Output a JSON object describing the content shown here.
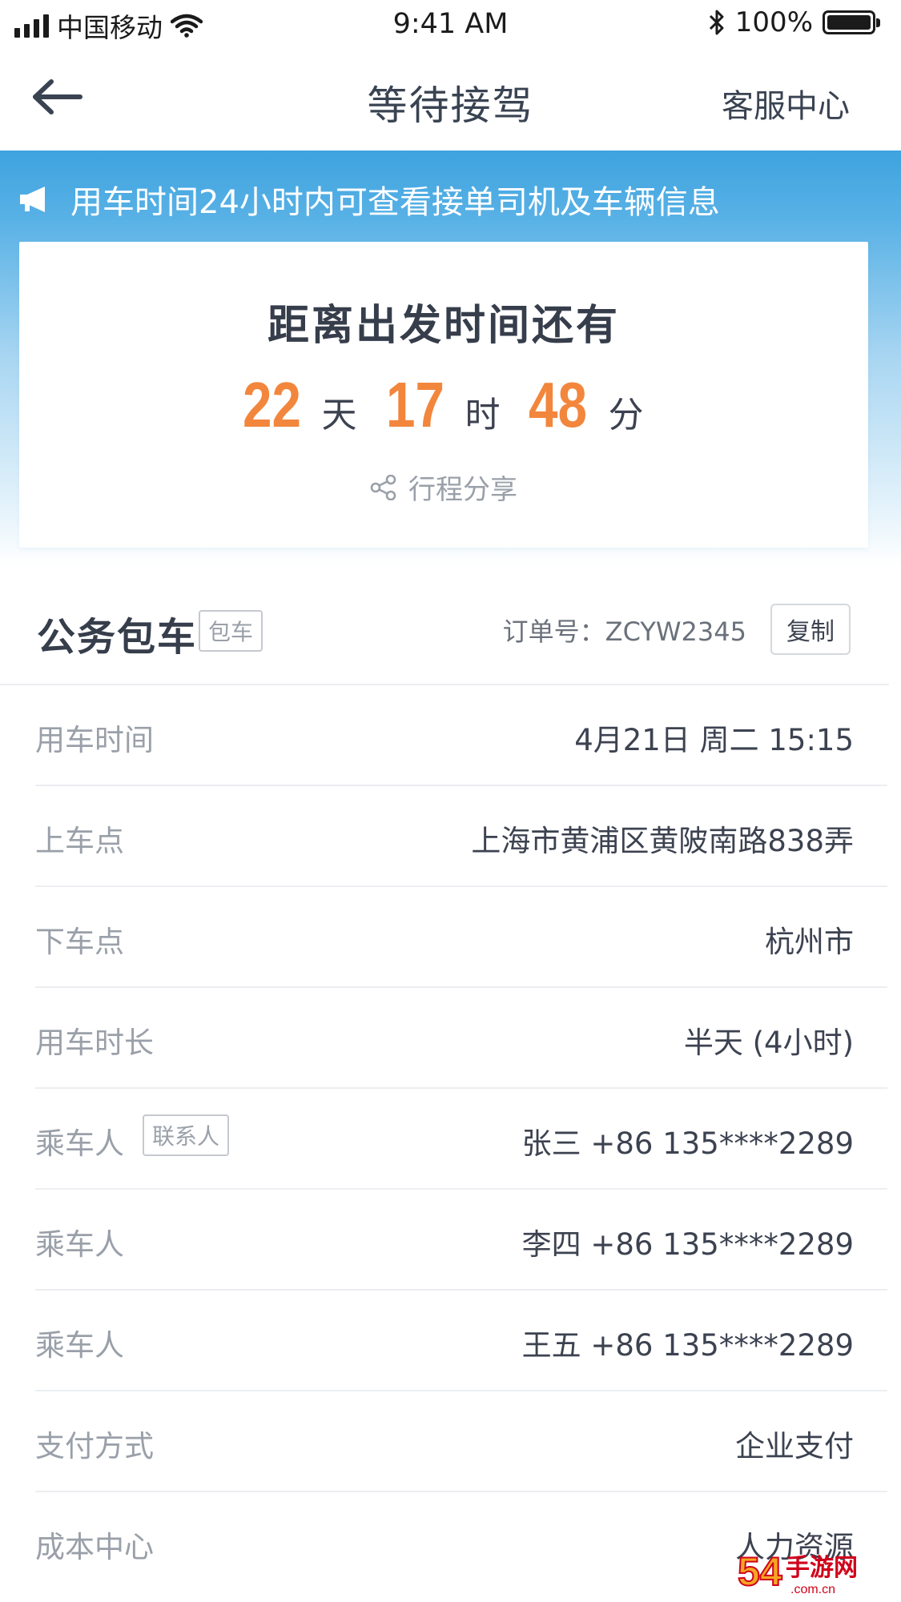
{
  "status_bar": {
    "carrier": "中国移动",
    "time": "9:41 AM",
    "battery_text": "100%",
    "battery_level": 1.0,
    "icons": [
      "signal-icon",
      "wifi-icon",
      "bluetooth-icon",
      "battery-icon"
    ]
  },
  "nav": {
    "title": "等待接驾",
    "right_link": "客服中心",
    "back_icon": "arrow-left-icon"
  },
  "notice": {
    "text": "用车时间24小时内可查看接单司机及车辆信息",
    "icon": "megaphone-icon"
  },
  "countdown": {
    "title": "距离出发时间还有",
    "days": "22",
    "days_unit": "天",
    "hours": "17",
    "hours_unit": "时",
    "minutes": "48",
    "minutes_unit": "分",
    "share_label": "行程分享",
    "share_icon": "share-icon"
  },
  "order": {
    "service_name": "公务包车",
    "service_tag": "包车",
    "order_no_label": "订单号：ZCYW2345",
    "copy_label": "复制"
  },
  "rows": [
    {
      "label": "用车时间",
      "value": "4月21日 周二 15:15"
    },
    {
      "label": "上车点",
      "value": "上海市黄浦区黄陂南路838弄"
    },
    {
      "label": "下车点",
      "value": "杭州市"
    },
    {
      "label": "用车时长",
      "value": "半天 (4小时)"
    },
    {
      "label": "乘车人",
      "tag": "联系人",
      "value": "张三 +86 135****2289"
    },
    {
      "label": "乘车人",
      "value": "李四 +86 135****2289"
    },
    {
      "label": "乘车人",
      "value": "王五 +86 135****2289"
    },
    {
      "label": "支付方式",
      "value": "企业支付"
    },
    {
      "label": "成本中心",
      "value": "人力资源"
    }
  ],
  "colors": {
    "accent_orange": "#f2863c",
    "header_blue": "#3ea3df",
    "text_dark": "#3c4250",
    "text_muted": "#9aa0a9"
  }
}
